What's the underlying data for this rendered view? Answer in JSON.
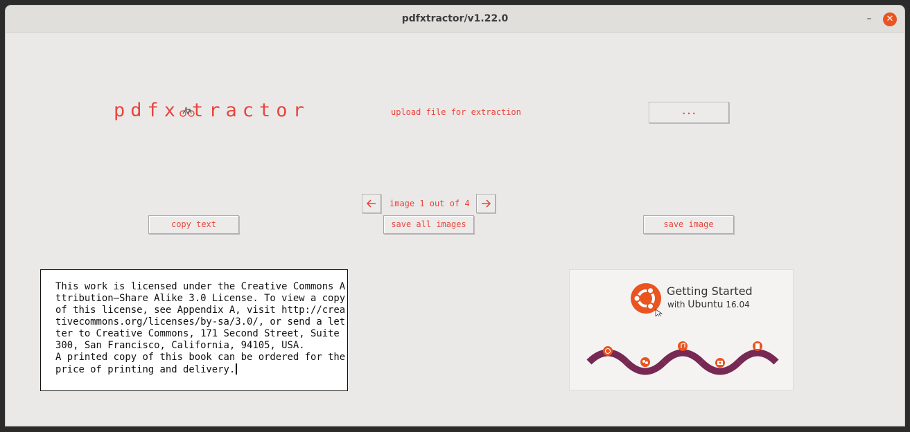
{
  "window": {
    "title": "pdfxtractor/v1.22.0",
    "minimize_glyph": "–",
    "close_glyph": "✕"
  },
  "logo": {
    "text_left": "pdfx",
    "text_right": "tractor",
    "icon": "bicycle-icon"
  },
  "upload": {
    "label": "upload file for extraction",
    "browse_label": "..."
  },
  "navigation": {
    "prev_glyph": "🡐",
    "next_glyph": "🡒",
    "counter": "image 1 out of 4"
  },
  "actions": {
    "copy_text": "copy text",
    "save_all_images": "save all images",
    "save_image": "save image"
  },
  "extracted_text": "This work is licensed under the Creative Commons A\nttribution–Share Alike 3.0 License. To view a copy\nof this license, see Appendix A, visit http://crea\ntivecommons.org/licenses/by-sa/3.0/, or send a let\nter to Creative Commons, 171 Second Street, Suite\n300, San Francisco, California, 94105, USA.\nA printed copy of this book can be ordered for the\nprice of printing and delivery.",
  "preview_image": {
    "title": "Getting Started",
    "subtitle_prefix": "with",
    "subtitle_brand": "Ubuntu",
    "subtitle_version": "16.04"
  },
  "colors": {
    "accent": "#e8453c",
    "ubuntu_orange": "#e95420",
    "ubuntu_purple": "#772953",
    "window_bg": "#eae9e8"
  }
}
